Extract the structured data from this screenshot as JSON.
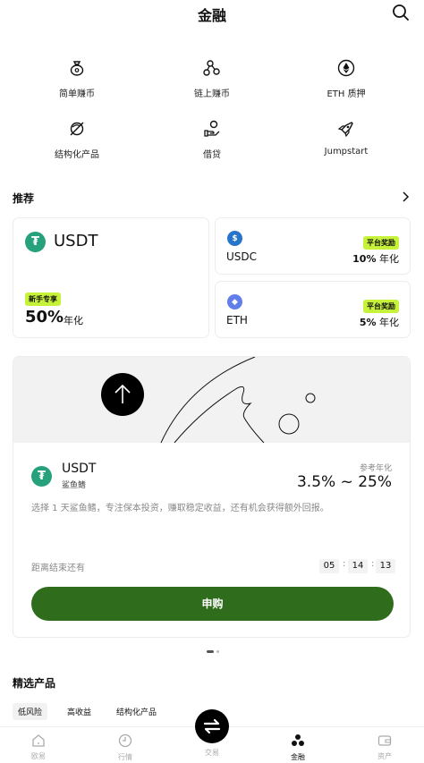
{
  "header": {
    "title": "金融"
  },
  "quick": [
    {
      "label": "简单赚币",
      "icon": "money-bag-icon"
    },
    {
      "label": "链上赚币",
      "icon": "nodes-icon"
    },
    {
      "label": "ETH 质押",
      "icon": "ethereum-icon"
    },
    {
      "label": "结构化产品",
      "icon": "shuffle-icon"
    },
    {
      "label": "借贷",
      "icon": "hand-coin-icon"
    },
    {
      "label": "Jumpstart",
      "icon": "rocket-icon"
    }
  ],
  "recommend": {
    "title": "推荐",
    "main": {
      "coin": "USDT",
      "tag": "新手专享",
      "rate": "50%",
      "unit": "年化"
    },
    "side": [
      {
        "coin": "USDC",
        "tag": "平台奖励",
        "rate": "10%",
        "unit": "年化"
      },
      {
        "coin": "ETH",
        "tag": "平台奖励",
        "rate": "5%",
        "unit": "年化"
      }
    ]
  },
  "product": {
    "coin": "USDT",
    "sub": "鲨鱼鳍",
    "ref_label": "参考年化",
    "rate": "3.5% ~ 25%",
    "desc": "选择 1 天鲨鱼鳍，专注保本投资，赚取稳定收益，还有机会获得额外回报。",
    "countdown_label": "距离结束还有",
    "time": [
      "05",
      "14",
      "13"
    ],
    "button": "申购"
  },
  "featured": {
    "title": "精选产品",
    "chips": [
      "低风险",
      "高收益",
      "结构化产品"
    ]
  },
  "nav": [
    {
      "label": "欧易",
      "icon": "home-icon"
    },
    {
      "label": "行情",
      "icon": "market-icon"
    },
    {
      "label": "交易",
      "icon": "trade-swap-icon"
    },
    {
      "label": "金融",
      "icon": "finance-icon"
    },
    {
      "label": "资产",
      "icon": "wallet-icon"
    }
  ],
  "colors": {
    "accent": "#2f6d1c",
    "tag": "#c6f23a",
    "usdt": "#26a17b",
    "usdc": "#2775ca",
    "eth": "#627eea"
  }
}
